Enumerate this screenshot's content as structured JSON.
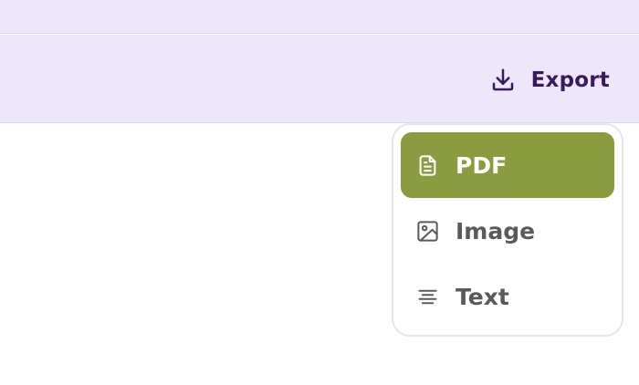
{
  "toolbar": {
    "export": {
      "label": "Export",
      "icon": "download-icon"
    }
  },
  "export_menu": {
    "items": [
      {
        "label": "PDF",
        "icon": "document-icon",
        "selected": true
      },
      {
        "label": "Image",
        "icon": "image-icon",
        "selected": false
      },
      {
        "label": "Text",
        "icon": "text-align-center-icon",
        "selected": false
      }
    ]
  },
  "colors": {
    "header_bg": "#eee6fb",
    "accent_text": "#3a1a5e",
    "selected_item_bg": "#8a9c3f",
    "item_text": "#5a5a5a"
  }
}
